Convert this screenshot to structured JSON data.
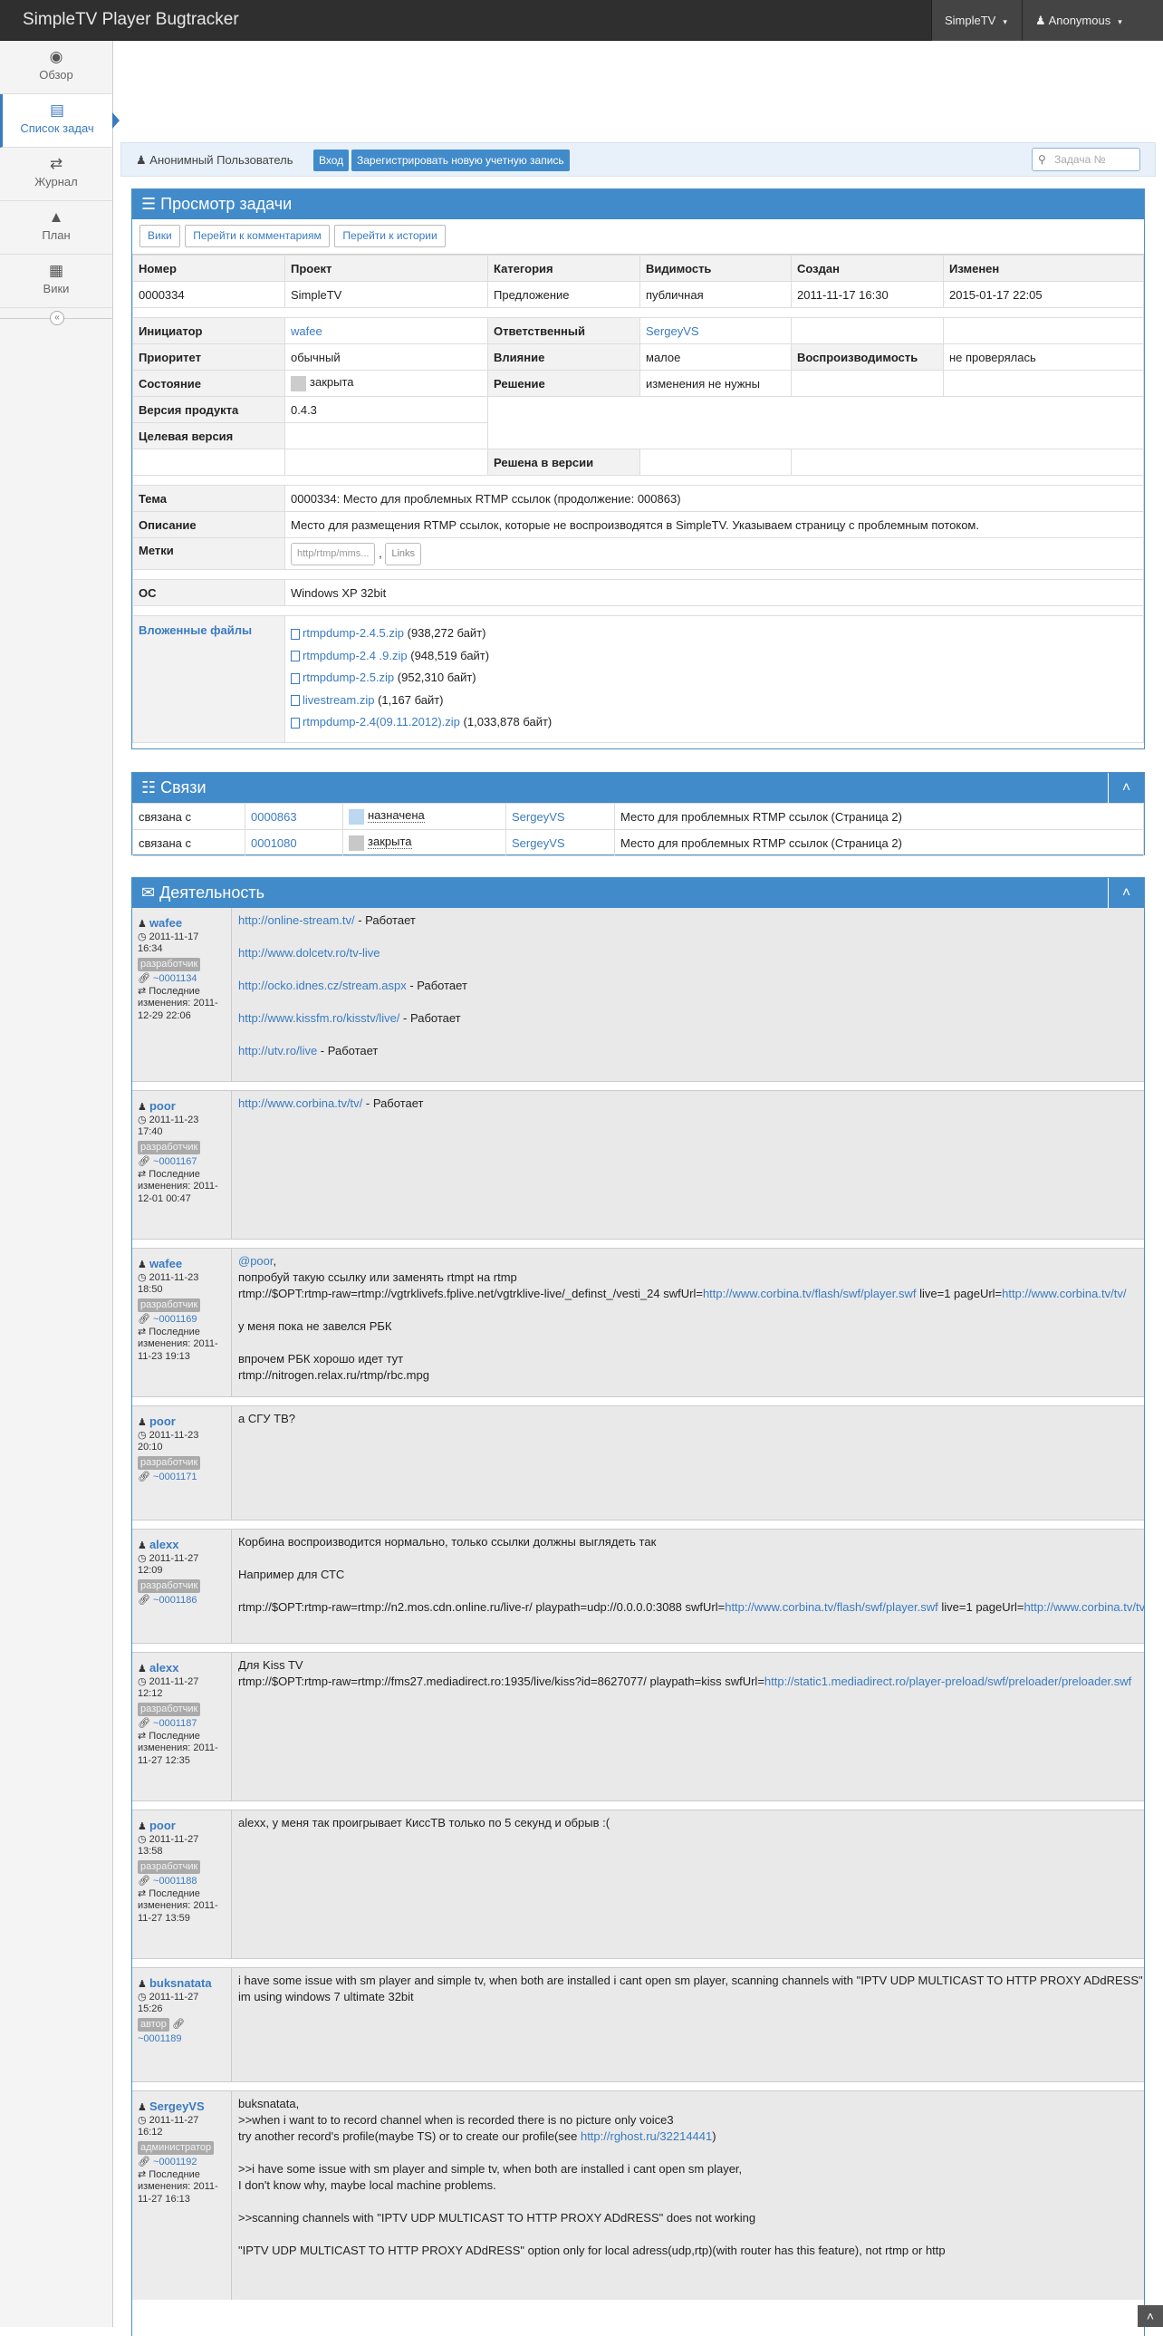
{
  "topbar": {
    "brand": "SimpleTV Player Bugtracker",
    "project_menu": "SimpleTV",
    "user_menu": "Anonymous"
  },
  "sidebar": {
    "items": [
      {
        "label": "Обзор",
        "icon": "dashboard-icon"
      },
      {
        "label": "Список задач",
        "icon": "list-icon"
      },
      {
        "label": "Журнал",
        "icon": "retweet-icon"
      },
      {
        "label": "План",
        "icon": "road-icon"
      },
      {
        "label": "Вики",
        "icon": "book-icon"
      }
    ]
  },
  "userbar": {
    "username": "Анонимный Пользователь",
    "login": "Вход",
    "register": "Зарегистрировать новую учетную запись",
    "search_placeholder": "Задача №"
  },
  "view": {
    "title": "Просмотр задачи",
    "buttons": [
      "Вики",
      "Перейти к комментариям",
      "Перейти к истории"
    ],
    "summary_headers": [
      "Номер",
      "Проект",
      "Категория",
      "Видимость",
      "Создан",
      "Изменен"
    ],
    "summary_values": [
      "0000334",
      "SimpleTV",
      "Предложение",
      "публичная",
      "2011-11-17 16:30",
      "2015-01-17 22:05"
    ],
    "reporter_label": "Инициатор",
    "reporter": "wafee",
    "handler_label": "Ответственный",
    "handler": "SergeyVS",
    "priority_label": "Приоритет",
    "priority": "обычный",
    "severity_label": "Влияние",
    "severity": "малое",
    "repro_label": "Воспроизводимость",
    "repro": "не проверялась",
    "status_label": "Состояние",
    "status": "закрыта",
    "resolution_label": "Решение",
    "resolution": "изменения не нужны",
    "version_label": "Версия продукта",
    "version": "0.4.3",
    "target_label": "Целевая версия",
    "fixed_label": "Решена в версии",
    "summary_label": "Тема",
    "summary": "0000334: Место для проблемных RTMP ссылок (продолжение: 000863)",
    "desc_label": "Описание",
    "desc": "Место для размещения RTMP ссылок, которые не воспроизводятся в SimpleTV. Указываем страницу с проблемным потоком.",
    "tags_label": "Метки",
    "tag_placeholder": "http/rtmp/mms...",
    "tag_sep": ",",
    "tag_links": "Links",
    "os_label": "ОС",
    "os": "Windows XP 32bit",
    "files_label": "Вложенные файлы",
    "files": [
      {
        "name": "rtmpdump-2.4.5.zip",
        "size": "(938,272 байт)"
      },
      {
        "name": "rtmpdump-2.4 .9.zip",
        "size": "(948,519 байт)"
      },
      {
        "name": "rtmpdump-2.5.zip",
        "size": "(952,310 байт)"
      },
      {
        "name": "livestream.zip",
        "size": "(1,167 байт)"
      },
      {
        "name": "rtmpdump-2.4(09.11.2012).zip",
        "size": "(1,033,878 байт)"
      }
    ]
  },
  "relations": {
    "title": "Связи",
    "rows": [
      {
        "type": "связана с",
        "id": "0000863",
        "status": "назначена",
        "status_color": "#bcd7f0",
        "handler": "SergeyVS",
        "summary": "Место для проблемных RTMP ссылок (Страница 2)"
      },
      {
        "type": "связана с",
        "id": "0001080",
        "status": "закрыта",
        "status_color": "#c8c8c8",
        "handler": "SergeyVS",
        "summary": "Место для проблемных RTMP ссылок (Страница 2)"
      }
    ]
  },
  "activity": {
    "title": "Деятельность",
    "items": [
      {
        "author": "wafee",
        "date": "2011-11-17",
        "time": "16:34",
        "role": "разработчик",
        "ref": "~0001134",
        "edited_label": "Последние изменения:",
        "edited": "2011-12-29 22:06",
        "lines": [
          {
            "link": "http://online-stream.tv/",
            "text": " - Работает"
          },
          {
            "link": "http://www.dolcetv.ro/tv-live",
            "text": ""
          },
          {
            "link": "http://ocko.idnes.cz/stream.aspx",
            "text": " - Работает"
          },
          {
            "link": "http://www.kissfm.ro/kisstv/live/",
            "text": " - Работает"
          },
          {
            "link": "http://utv.ro/live",
            "text": " - Работает"
          }
        ]
      },
      {
        "author": "poor",
        "date": "2011-11-23",
        "time": "17:40",
        "role": "разработчик",
        "ref": "~0001167",
        "edited_label": "Последние изменения:",
        "edited": "2011-12-01 00:47",
        "lines": [
          {
            "link": "http://www.corbina.tv/tv/",
            "text": " - Работает"
          }
        ]
      },
      {
        "author": "wafee",
        "date": "2011-11-23",
        "time": "18:50",
        "role": "разработчик",
        "ref": "~0001169",
        "edited_label": "Последние изменения:",
        "edited": "2011-11-23 19:13",
        "mention": "@poor",
        "l1": "попробуй такую ссылку или заменять rtmpt на rtmp",
        "l2a": "rtmp://$OPT:rtmp-raw=rtmp://vgtrklivefs.fplive.net/vgtrklive-live/_definst_/vesti_24 swfUrl=",
        "l2link": "http://www.corbina.tv/flash/swf/player.swf",
        "l2b": " live=1 pageUrl=",
        "l2link2": "http://www.corbina.tv/tv/",
        "l3": "у меня пока не завелся РБК",
        "l4": "впрочем РБК хорошо идет тут",
        "l5": "rtmp://nitrogen.relax.ru/rtmp/rbc.mpg"
      },
      {
        "author": "poor",
        "date": "2011-11-23",
        "time": "20:10",
        "role": "разработчик",
        "ref": "~0001171",
        "text": "а СГУ ТВ?"
      },
      {
        "author": "alexx",
        "date": "2011-11-27",
        "time": "12:09",
        "role": "разработчик",
        "ref": "~0001186",
        "l1": "Корбина воспроизводится нормально, только ссылки должны выглядеть так",
        "l2": "Например для СТС",
        "l3a": "rtmp://$OPT:rtmp-raw=rtmp://n2.mos.cdn.online.ru/live-r/ playpath=udp://0.0.0.0:3088 swfUrl=",
        "l3link": "http://www.corbina.tv/flash/swf/player.swf",
        "l3b": " live=1 pageUrl=",
        "l3link2": "http://www.corbina.tv/tv/"
      },
      {
        "author": "alexx",
        "date": "2011-11-27",
        "time": "12:12",
        "role": "разработчик",
        "ref": "~0001187",
        "edited_label": "Последние изменения:",
        "edited": "2011-11-27 12:35",
        "l1": "Для Kiss TV",
        "l2a": "rtmp://$OPT:rtmp-raw=rtmp://fms27.mediadirect.ro:1935/live/kiss?id=8627077/ playpath=kiss swfUrl=",
        "l2link": "http://static1.mediadirect.ro/player-preload/swf/preloader/preloader.swf"
      },
      {
        "author": "poor",
        "date": "2011-11-27",
        "time": "13:58",
        "role": "разработчик",
        "ref": "~0001188",
        "edited_label": "Последние изменения:",
        "edited": "2011-11-27 13:59",
        "text": "alexx, у меня так проигрывает КиссТВ только по 5 секунд и обрыв :("
      },
      {
        "author": "buksnatata",
        "date": "2011-11-27",
        "time": "15:26",
        "role": "автор",
        "ref": "~0001189",
        "l1": "i have some issue with sm player and simple tv, when both are installed i cant open sm player, scanning channels with \"IPTV UDP MULTICAST TO HTTP PROXY ADdRESS\" does not working",
        "l2": "im using windows 7 ultimate 32bit"
      },
      {
        "author": "SergeyVS",
        "date": "2011-11-27",
        "time": "16:12",
        "role": "администратор",
        "ref": "~0001192",
        "edited_label": "Последние изменения:",
        "edited": "2011-11-27 16:13",
        "l1": "buksnatata,",
        "l2": ">>when i want to to record channel when is recorded there is no picture only voice3",
        "l3a": "try another record's profile(maybe TS) or to create our profile(see ",
        "l3link": "http://rghost.ru/32214441",
        "l3b": ")",
        "l4": ">>i have some issue with sm player and simple tv, when both are installed i cant open sm player,",
        "l5": "I don't know why, maybe local machine problems.",
        "l6": ">>scanning channels with \"IPTV UDP MULTICAST TO HTTP PROXY ADdRESS\" does not working",
        "l7": "\"IPTV UDP MULTICAST TO HTTP PROXY ADdRESS\" option only for local adress(udp,rtp)(with router has this feature), not rtmp or http"
      }
    ]
  }
}
